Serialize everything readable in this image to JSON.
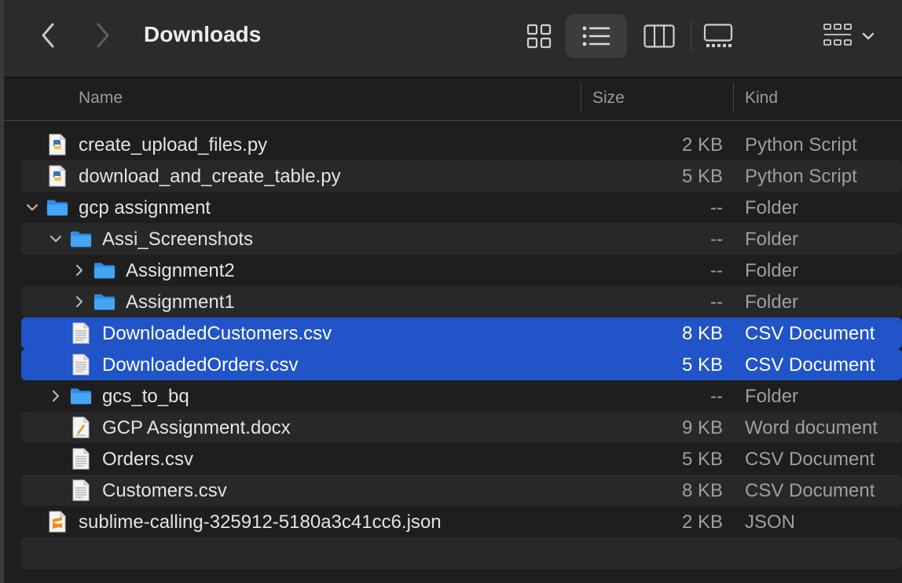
{
  "toolbar": {
    "title": "Downloads",
    "back_icon": "chevron-left-icon",
    "forward_icon": "chevron-right-icon",
    "views": [
      "icon-view",
      "list-view",
      "column-view",
      "gallery-view"
    ],
    "active_view": "list-view",
    "group_menu_icon": "group-by-icon"
  },
  "columns": {
    "name": "Name",
    "size": "Size",
    "kind": "Kind"
  },
  "colors": {
    "selection": "#2054c8",
    "folder": "#43a5f5",
    "background": "#1e1e1e"
  },
  "rows": [
    {
      "name": "create_upload_files.py",
      "size": "2 KB",
      "kind": "Python Script",
      "icon": "python-file-icon",
      "level": 0,
      "disclosure": "none",
      "selected": false
    },
    {
      "name": "download_and_create_table.py",
      "size": "5 KB",
      "kind": "Python Script",
      "icon": "python-file-icon",
      "level": 0,
      "disclosure": "none",
      "selected": false
    },
    {
      "name": "gcp assignment",
      "size": "--",
      "kind": "Folder",
      "icon": "folder-icon",
      "level": 0,
      "disclosure": "expanded",
      "selected": false
    },
    {
      "name": "Assi_Screenshots",
      "size": "--",
      "kind": "Folder",
      "icon": "folder-icon",
      "level": 1,
      "disclosure": "expanded",
      "selected": false
    },
    {
      "name": "Assignment2",
      "size": "--",
      "kind": "Folder",
      "icon": "folder-icon",
      "level": 2,
      "disclosure": "collapsed",
      "selected": false
    },
    {
      "name": "Assignment1",
      "size": "--",
      "kind": "Folder",
      "icon": "folder-icon",
      "level": 2,
      "disclosure": "collapsed",
      "selected": false
    },
    {
      "name": "DownloadedCustomers.csv",
      "size": "8 KB",
      "kind": "CSV Document",
      "icon": "csv-file-icon",
      "level": 1,
      "disclosure": "none",
      "selected": true
    },
    {
      "name": "DownloadedOrders.csv",
      "size": "5 KB",
      "kind": "CSV Document",
      "icon": "csv-file-icon",
      "level": 1,
      "disclosure": "none",
      "selected": true
    },
    {
      "name": "gcs_to_bq",
      "size": "--",
      "kind": "Folder",
      "icon": "folder-icon",
      "level": 1,
      "disclosure": "collapsed",
      "selected": false
    },
    {
      "name": "GCP Assignment.docx",
      "size": "9 KB",
      "kind": "Word document",
      "icon": "word-doc-icon",
      "level": 1,
      "disclosure": "none",
      "selected": false
    },
    {
      "name": "Orders.csv",
      "size": "5 KB",
      "kind": "CSV Document",
      "icon": "csv-file-icon",
      "level": 1,
      "disclosure": "none",
      "selected": false
    },
    {
      "name": "Customers.csv",
      "size": "8 KB",
      "kind": "CSV Document",
      "icon": "csv-file-icon",
      "level": 1,
      "disclosure": "none",
      "selected": false
    },
    {
      "name": "sublime-calling-325912-5180a3c41cc6.json",
      "size": "2 KB",
      "kind": "JSON",
      "icon": "sublime-json-icon",
      "level": 0,
      "disclosure": "none",
      "selected": false
    }
  ]
}
